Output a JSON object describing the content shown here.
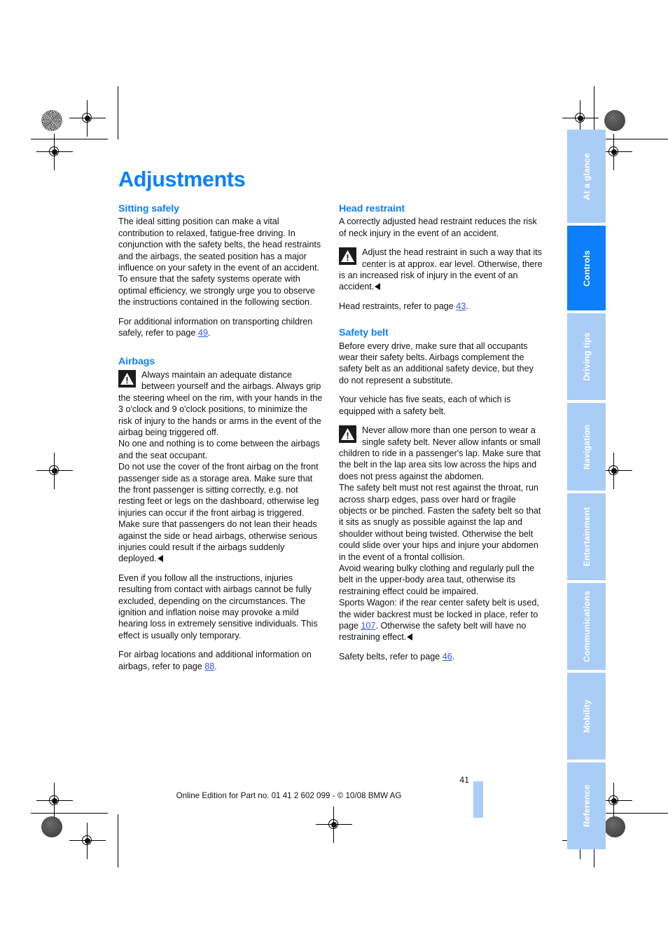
{
  "document": {
    "title": "Adjustments",
    "page_number": "41",
    "footer_note": "Online Edition for Part no. 01 41 2 602 099 - © 10/08 BMW AG"
  },
  "left_column": {
    "section1": {
      "heading": "Sitting safely",
      "paragraphs": [
        "The ideal sitting position can make a vital contribution to relaxed, fatigue-free driving. In conjunction with the safety belts, the head restraints and the airbags, the seated position has a major influence on your safety in the event of an accident. To ensure that the safety systems operate with optimal efficiency, we strongly urge you to observe the instructions contained in the following section."
      ],
      "cross_ref_pre": "For additional information on transporting children safely, refer to page ",
      "cross_ref_page": "49",
      "cross_ref_post": "."
    },
    "section2": {
      "heading": "Airbags",
      "warning_text": "Always maintain an adequate distance between yourself and the airbags. Always grip the steering wheel on the rim, with your hands in the 3 o'clock and 9 o'clock positions, to minimize the risk of injury to the hands or arms in the event of the airbag being triggered off.\nNo one and nothing is to come between the airbags and the seat occupant.\nDo not use the cover of the front airbag on the front passenger side as a storage area. Make sure that the front passenger is sitting correctly, e.g. not resting feet or legs on the dashboard, otherwise leg injuries can occur if the front airbag is triggered.\nMake sure that passengers do not lean their heads against the side or head airbags, otherwise serious injuries could result if the airbags suddenly deployed.",
      "paragraph": "Even if you follow all the instructions, injuries resulting from contact with airbags cannot be fully excluded, depending on the circumstances. The ignition and inflation noise may provoke a mild hearing loss in extremely sensitive individuals. This effect is usually only temporary.",
      "cross_ref_pre": "For airbag locations and additional information on airbags, refer to page ",
      "cross_ref_page": "88",
      "cross_ref_post": "."
    }
  },
  "right_column": {
    "section1": {
      "heading": "Head restraint",
      "intro": "A correctly adjusted head restraint reduces the risk of neck injury in the event of an accident.",
      "warning_text": "Adjust the head restraint in such a way that its center is at approx. ear level. Otherwise, there is an increased risk of injury in the event of an accident.",
      "cross_ref_pre": "Head restraints, refer to page ",
      "cross_ref_page": "43",
      "cross_ref_post": "."
    },
    "section2": {
      "heading": "Safety belt",
      "intro1": "Before every drive, make sure that all occupants wear their safety belts. Airbags complement the safety belt as an additional safety device, but they do not represent a substitute.",
      "intro2": "Your vehicle has five seats, each of which is equipped with a safety belt.",
      "warning_text": "Never allow more than one person to wear a single safety belt. Never allow infants or small children to ride in a passenger's lap. Make sure that the belt in the lap area sits low across the hips and does not press against the abdomen.\nThe safety belt must not rest against the throat, run across sharp edges, pass over hard or fragile objects or be pinched. Fasten the safety belt so that it sits as snugly as possible against the lap and shoulder without being twisted. Otherwise the belt could slide over your hips and injure your abdomen in the event of a frontal collision.\nAvoid wearing bulky clothing and regularly pull the belt in the upper-body area taut, otherwise its restraining effect could be impaired.\nSports Wagon: if the rear center safety belt is used, the wider backrest must be locked in place, refer to page ",
      "warning_link_page": "107",
      "warning_text_after": ". Otherwise the safety belt will have no restraining effect.",
      "cross_ref_pre": "Safety belts, refer to page ",
      "cross_ref_page": "46",
      "cross_ref_post": "."
    }
  },
  "index_tabs": {
    "active": "Controls",
    "items": [
      {
        "label": "At a glance",
        "active": false
      },
      {
        "label": "Controls",
        "active": true
      },
      {
        "label": "Driving tips",
        "active": false
      },
      {
        "label": "Navigation",
        "active": false
      },
      {
        "label": "Entertainment",
        "active": false
      },
      {
        "label": "Communications",
        "active": false
      },
      {
        "label": "Mobility",
        "active": false
      },
      {
        "label": "Reference",
        "active": false
      }
    ]
  },
  "colors": {
    "accent_blue": "#0d7ffc",
    "tab_inactive_blue": "#aacdf8",
    "link_blue": "#2f54ff",
    "body_text": "#111111"
  },
  "icons": {
    "warning": "warning-triangle-icon",
    "end_of_warning": "end-of-warning-marker"
  }
}
